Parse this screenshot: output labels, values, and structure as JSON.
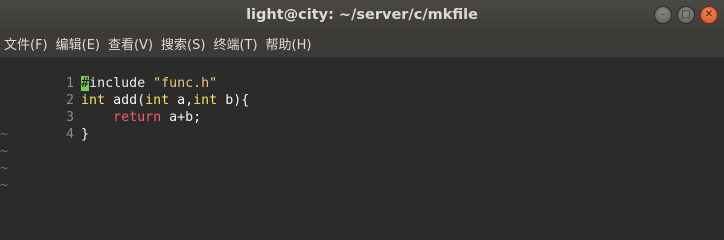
{
  "window": {
    "title": "light@city: ~/server/c/mkfile",
    "controls": {
      "minimize_glyph": "–",
      "maximize_glyph": "□",
      "close_glyph": "✕"
    }
  },
  "menu": {
    "items": [
      {
        "label": "文件(F)"
      },
      {
        "label": "编辑(E)"
      },
      {
        "label": "查看(V)"
      },
      {
        "label": "搜索(S)"
      },
      {
        "label": "终端(T)"
      },
      {
        "label": "帮助(H)"
      }
    ]
  },
  "editor": {
    "lines": [
      {
        "num": "1",
        "cursor_char": "#",
        "rest_pre": "include ",
        "string": "\"func.h\""
      },
      {
        "num": "2",
        "t1": "int",
        "mid1": " add(",
        "t2": "int",
        "mid2": " a,",
        "t3": "int",
        "mid3": " b){"
      },
      {
        "num": "3",
        "indent": "    ",
        "kw": "return",
        "rest": " a+b;"
      },
      {
        "num": "4",
        "text": "}"
      }
    ],
    "empty_marker": "~"
  },
  "colors": {
    "background": "#2b2b2b",
    "cursor": "#7ec854",
    "string": "#f0c674",
    "type": "#f6e05b",
    "return_keyword": "#ef5f6b",
    "line_number": "#8a8a8a",
    "tilde": "#6c6c9c"
  }
}
